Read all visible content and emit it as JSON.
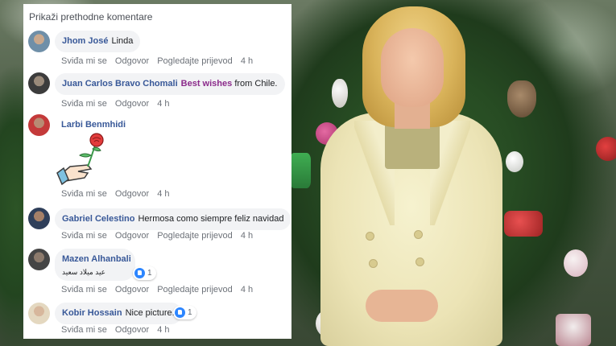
{
  "panel": {
    "show_previous": "Prikaži prethodne komentare",
    "actions": {
      "like": "Sviđa mi se",
      "reply": "Odgovor",
      "see_translation": "Pogledajte prijevod"
    },
    "comments": [
      {
        "author": "Jhom José",
        "text": "Linda",
        "time": "4 h"
      },
      {
        "author": "Juan Carlos Bravo Chomali",
        "highlight": "Best wishes",
        "text": "from Chile.",
        "time": "4 h"
      },
      {
        "author": "Larbi Benmhidi",
        "sticker": "flower-hand-sticker",
        "time": "4 h"
      },
      {
        "author": "Gabriel Celestino",
        "text": "Hermosa como siempre feliz navidad",
        "time": "4 h"
      },
      {
        "author": "Mazen Alhanbali",
        "text": "عيد ميلاد سعيد",
        "likes": "1",
        "time": "4 h"
      },
      {
        "author": "Kobir Hossain",
        "text": "Nice picture.",
        "likes": "1",
        "time": "4 h"
      }
    ]
  },
  "colors": {
    "name": "#385898",
    "bubble": "#f2f3f5",
    "meta": "#6d7279",
    "like": "#2d86ff",
    "highlight": "#8b2b8b"
  },
  "icons": [
    "like-icon",
    "flower-hand-sticker"
  ]
}
